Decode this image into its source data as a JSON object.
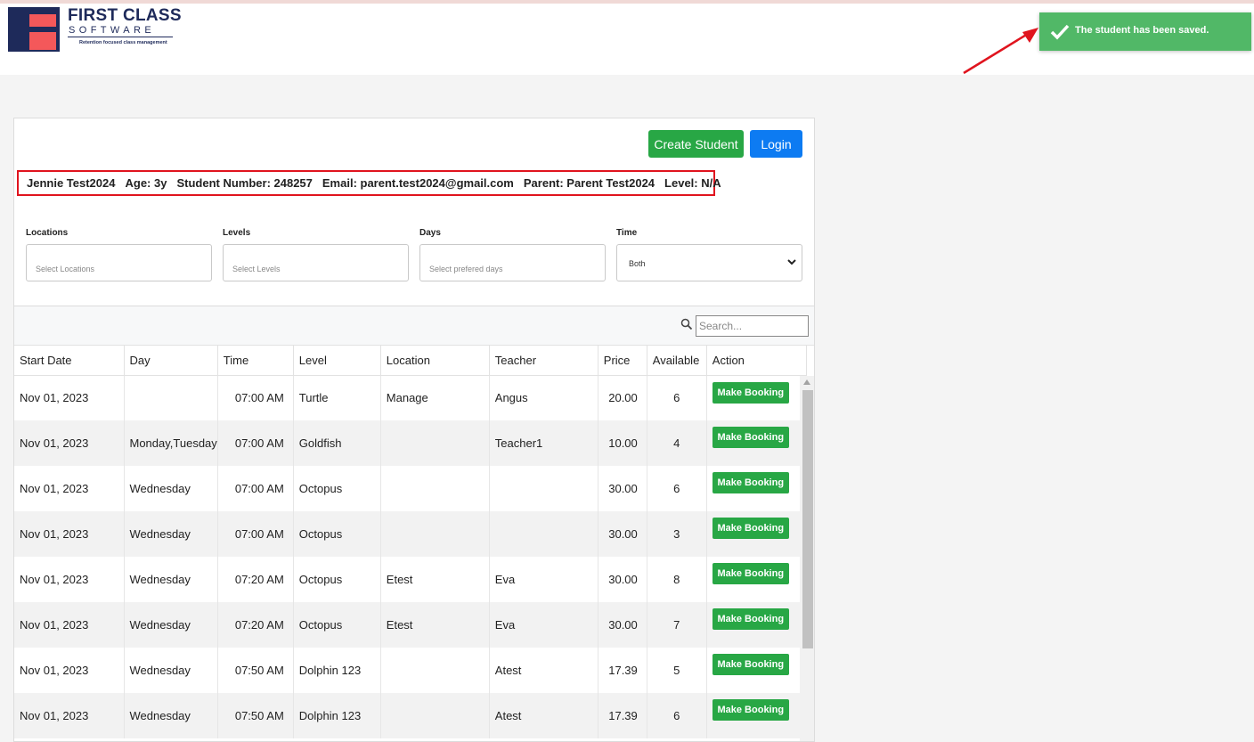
{
  "brand": {
    "name": "FIRST CLASS",
    "sub": "SOFTWARE",
    "tagline": "Retention focused class management",
    "colors": {
      "navy": "#1e2a5a",
      "coral": "#f4585a"
    }
  },
  "toast": {
    "message": "The student has been saved.",
    "color": "#51b867"
  },
  "actions": {
    "create_student": "Create Student",
    "login": "Login"
  },
  "student": {
    "name": "Jennie Test2024",
    "age": "Age: 3y",
    "number": "Student Number: 248257",
    "email": "Email: parent.test2024@gmail.com",
    "parent": "Parent: Parent Test2024",
    "level": "Level: N/A"
  },
  "filters": {
    "locations": {
      "label": "Locations",
      "placeholder": "Select Locations"
    },
    "levels": {
      "label": "Levels",
      "placeholder": "Select Levels"
    },
    "days": {
      "label": "Days",
      "placeholder": "Select prefered days"
    },
    "time": {
      "label": "Time",
      "value": "Both"
    }
  },
  "search": {
    "placeholder": "Search..."
  },
  "table": {
    "columns": [
      "Start Date",
      "Day",
      "Time",
      "Level",
      "Location",
      "Teacher",
      "Price",
      "Available",
      "Action"
    ],
    "booking_label": "Make Booking",
    "rows": [
      [
        "Nov 01, 2023",
        "",
        "07:00 AM",
        "Turtle",
        "Manage",
        "Angus",
        "20.00",
        "6"
      ],
      [
        "Nov 01, 2023",
        "Monday,Tuesday",
        "07:00 AM",
        "Goldfish",
        "",
        "Teacher1",
        "10.00",
        "4"
      ],
      [
        "Nov 01, 2023",
        "Wednesday",
        "07:00 AM",
        "Octopus",
        "",
        "",
        "30.00",
        "6"
      ],
      [
        "Nov 01, 2023",
        "Wednesday",
        "07:00 AM",
        "Octopus",
        "",
        "",
        "30.00",
        "3"
      ],
      [
        "Nov 01, 2023",
        "Wednesday",
        "07:20 AM",
        "Octopus",
        "Etest",
        "Eva",
        "30.00",
        "8"
      ],
      [
        "Nov 01, 2023",
        "Wednesday",
        "07:20 AM",
        "Octopus",
        "Etest",
        "Eva",
        "30.00",
        "7"
      ],
      [
        "Nov 01, 2023",
        "Wednesday",
        "07:50 AM",
        "Dolphin 123",
        "",
        "Atest",
        "17.39",
        "5"
      ],
      [
        "Nov 01, 2023",
        "Wednesday",
        "07:50 AM",
        "Dolphin 123",
        "",
        "Atest",
        "17.39",
        "6"
      ]
    ]
  }
}
